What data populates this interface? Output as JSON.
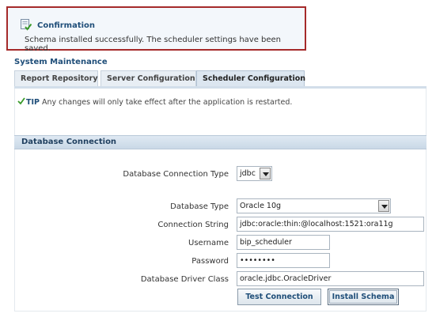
{
  "confirmation": {
    "title": "Confirmation",
    "message": "Schema installed successfully. The scheduler settings have been saved."
  },
  "system_maintenance": {
    "title": "System Maintenance",
    "tabs": [
      {
        "label": "Report Repository",
        "active": false
      },
      {
        "label": "Server Configuration",
        "active": false
      },
      {
        "label": "Scheduler Configuration",
        "active": true
      }
    ]
  },
  "tip": {
    "label": "TIP",
    "text": " Any changes will only take effect after the application is restarted."
  },
  "database_connection": {
    "section_title": "Database Connection",
    "connection_type_label": "Database Connection Type",
    "connection_type_value": "jdbc",
    "database_type_label": "Database Type",
    "database_type_value": "Oracle 10g",
    "connection_string_label": "Connection String",
    "connection_string_value": "jdbc:oracle:thin:@localhost:1521:ora11g",
    "username_label": "Username",
    "username_value": "bip_scheduler",
    "password_label": "Password",
    "password_value": "••••••••",
    "driver_class_label": "Database Driver Class",
    "driver_class_value": "oracle.jdbc.OracleDriver",
    "test_connection_label": "Test Connection",
    "install_schema_label": "Install Schema"
  },
  "icons": {
    "confirmation": "confirmation-checkmark-icon",
    "tip": "tip-check-icon",
    "dropdown": "chevron-down-icon"
  },
  "colors": {
    "highlight_border": "#a52a2a",
    "heading_blue": "#1f4e79",
    "section_header": "#c9d8e6"
  }
}
